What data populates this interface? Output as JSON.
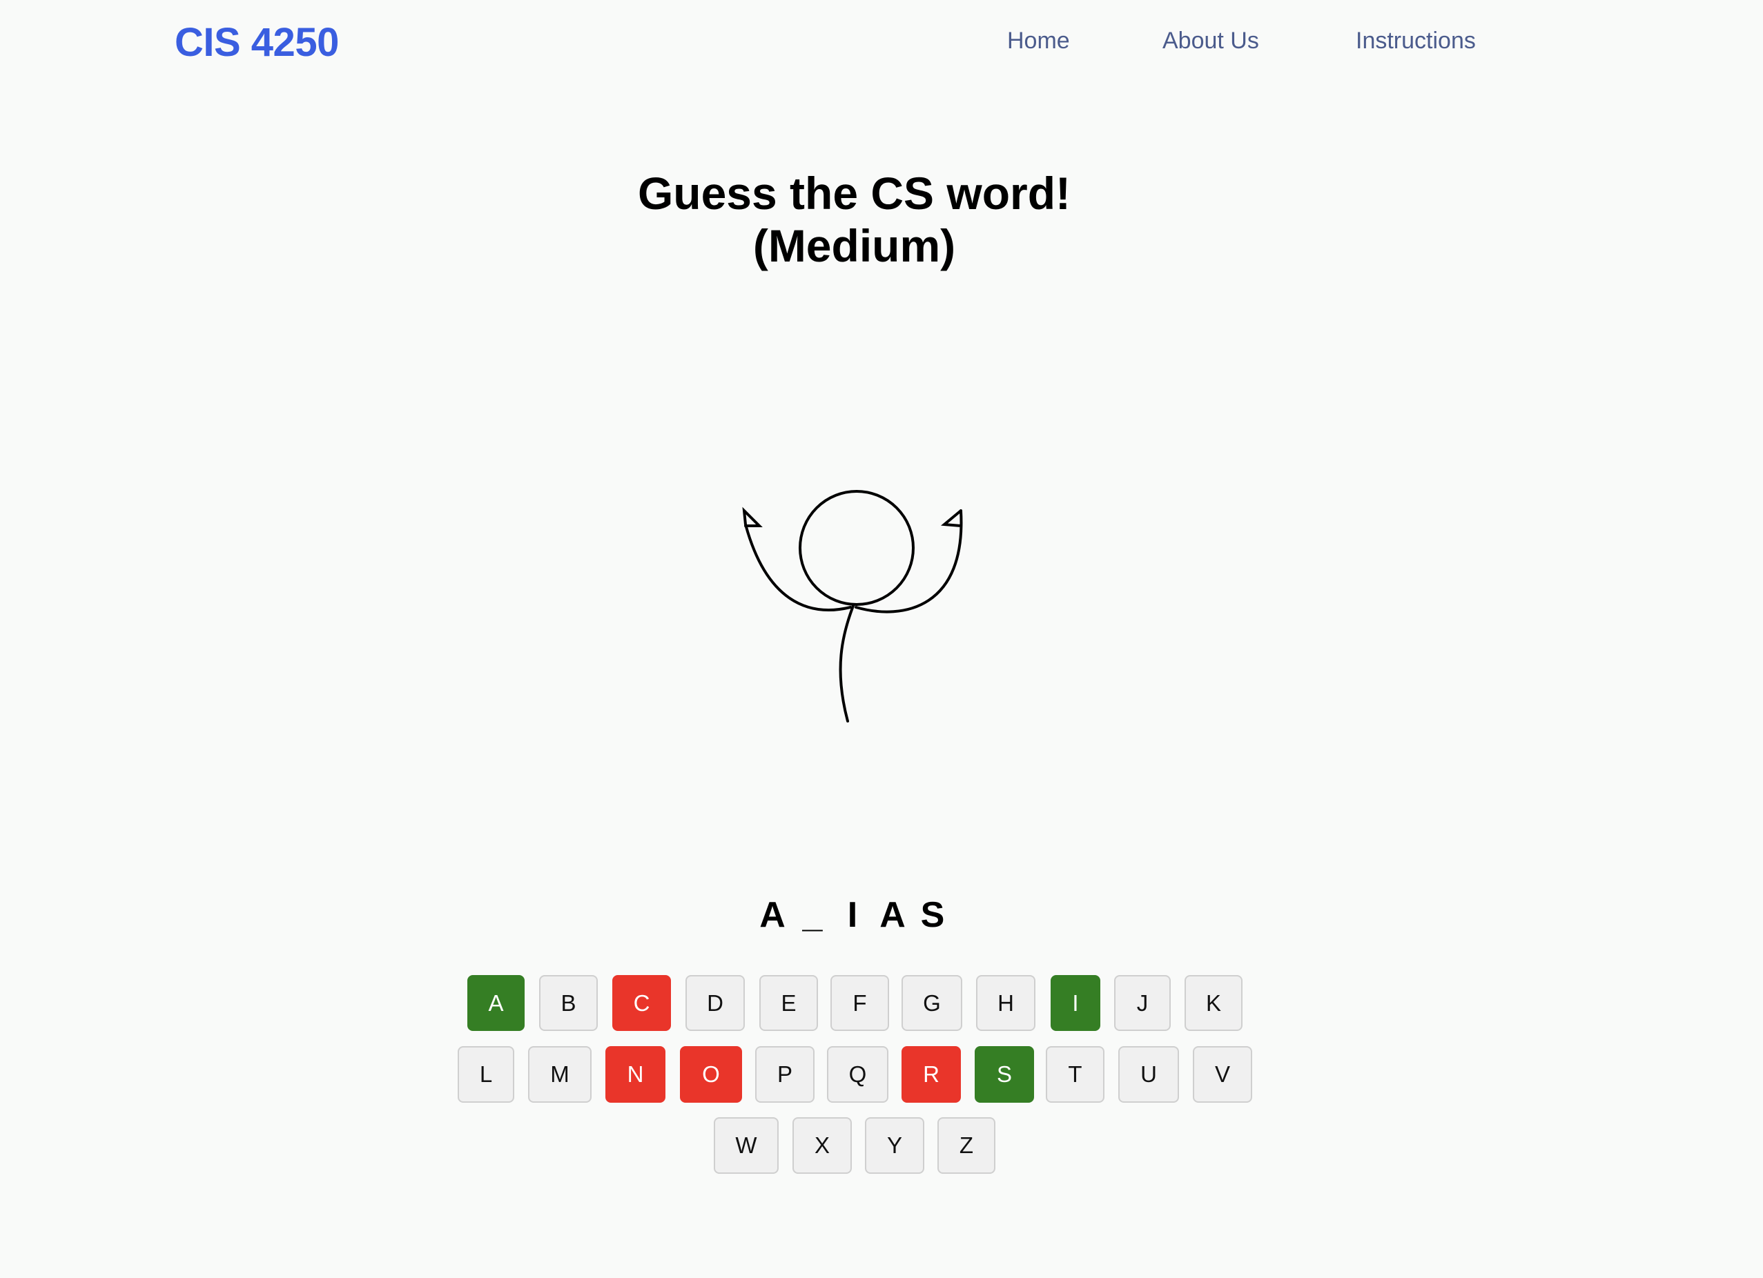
{
  "header": {
    "brand": "CIS 4250",
    "nav": [
      "Home",
      "About Us",
      "Instructions"
    ]
  },
  "game": {
    "title": "Guess the CS word! (Medium)",
    "word_slots": [
      "A",
      "_",
      "I",
      "A",
      "S"
    ],
    "keyboard": [
      {
        "letter": "A",
        "state": "correct"
      },
      {
        "letter": "B",
        "state": "unused"
      },
      {
        "letter": "C",
        "state": "wrong"
      },
      {
        "letter": "D",
        "state": "unused"
      },
      {
        "letter": "E",
        "state": "unused"
      },
      {
        "letter": "F",
        "state": "unused"
      },
      {
        "letter": "G",
        "state": "unused"
      },
      {
        "letter": "H",
        "state": "unused"
      },
      {
        "letter": "I",
        "state": "correct"
      },
      {
        "letter": "J",
        "state": "unused"
      },
      {
        "letter": "K",
        "state": "unused"
      },
      {
        "letter": "L",
        "state": "unused"
      },
      {
        "letter": "M",
        "state": "unused"
      },
      {
        "letter": "N",
        "state": "wrong"
      },
      {
        "letter": "O",
        "state": "wrong"
      },
      {
        "letter": "P",
        "state": "unused"
      },
      {
        "letter": "Q",
        "state": "unused"
      },
      {
        "letter": "R",
        "state": "wrong"
      },
      {
        "letter": "S",
        "state": "correct"
      },
      {
        "letter": "T",
        "state": "unused"
      },
      {
        "letter": "U",
        "state": "unused"
      },
      {
        "letter": "V",
        "state": "unused"
      },
      {
        "letter": "W",
        "state": "unused"
      },
      {
        "letter": "X",
        "state": "unused"
      },
      {
        "letter": "Y",
        "state": "unused"
      },
      {
        "letter": "Z",
        "state": "unused"
      }
    ]
  },
  "colors": {
    "brand": "#3a5ee0",
    "nav": "#4b5b8c",
    "correct": "#357e24",
    "wrong": "#e9352a",
    "unused": "#f0f0f0"
  }
}
